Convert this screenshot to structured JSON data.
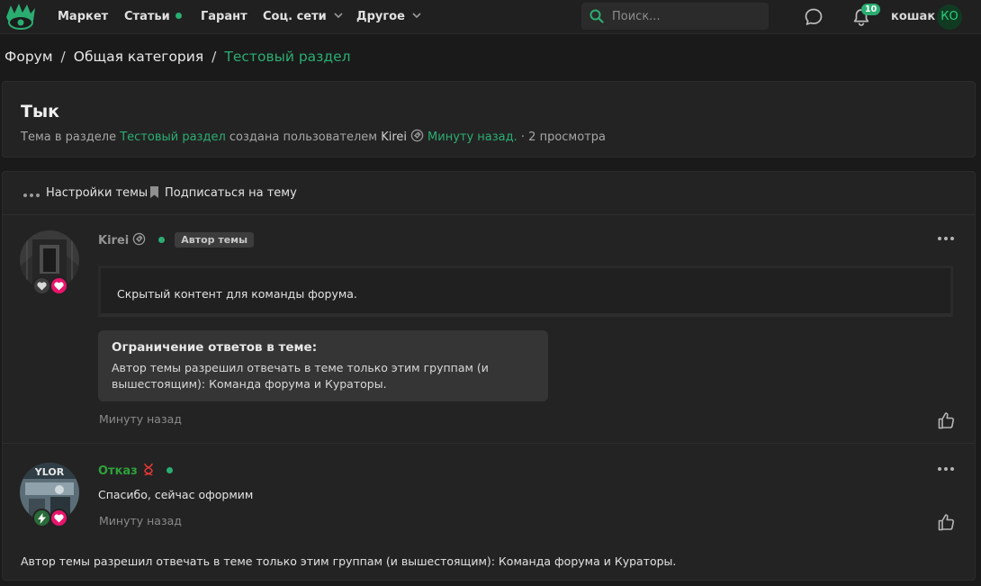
{
  "nav": {
    "items": [
      "Маркет",
      "Статьи",
      "Гарант",
      "Соц. сети",
      "Другое"
    ],
    "search_placeholder": "Поиск...",
    "notifications_count": "10",
    "username": "кошак",
    "avatar_initials": "КО"
  },
  "breadcrumb": {
    "items": [
      "Форум",
      "Общая категория",
      "Тестовый раздел"
    ],
    "separator": "/"
  },
  "thread": {
    "title": "Тык",
    "desc_prefix": "Тема в разделе",
    "section": "Тестовый раздел",
    "desc_middle": "созданa пользователем",
    "author": "Kirei",
    "time": "Минуту назад.",
    "views": "· 2 просмотра"
  },
  "actions": {
    "settings": "Настройки темы",
    "subscribe": "Подписаться на тему"
  },
  "posts": [
    {
      "author": "Kirei",
      "tag": "Автор темы",
      "hidden_content": "Скрытый контент для команды форума.",
      "restriction_title": "Ограничение ответов в теме:",
      "restriction_text": "Автор темы разрешил отвечать в теме только этим группам (и вышестоящим): Команда форума и Кураторы.",
      "date": "Минуту назад"
    },
    {
      "author": "Отказ",
      "message": "Спасибо, сейчас оформим",
      "date": "Минуту назад"
    }
  ],
  "footer_note": "Автор темы разрешил отвечать в теме только этим группам (и вышестоящим): Команда форума и Кураторы.",
  "colors": {
    "accent": "#2bad72",
    "background": "#1a1a1a",
    "block": "#232323",
    "pink_badge": "#e8146c"
  }
}
